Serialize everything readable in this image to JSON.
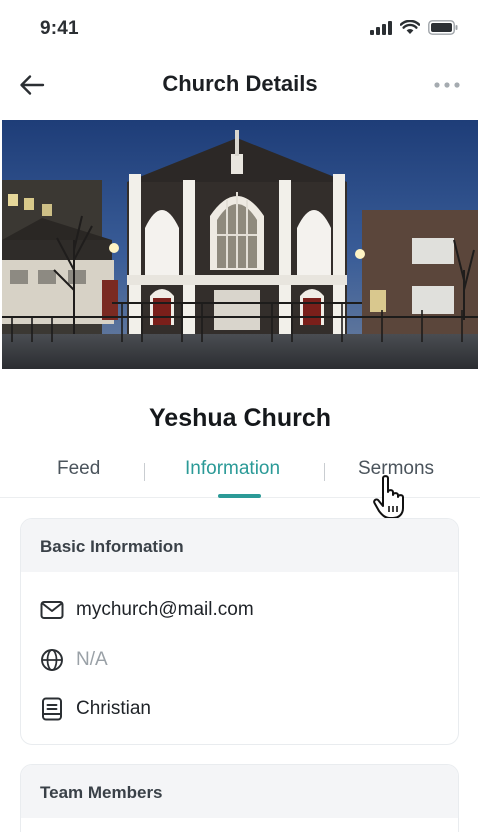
{
  "status_bar": {
    "time": "9:41"
  },
  "nav": {
    "title": "Church Details"
  },
  "church": {
    "name": "Yeshua Church"
  },
  "tabs": [
    {
      "label": "Feed",
      "active": false
    },
    {
      "label": "Information",
      "active": true
    },
    {
      "label": "Sermons",
      "active": false
    }
  ],
  "basic_info": {
    "title": "Basic Information",
    "email": "mychurch@mail.com",
    "website": "N/A",
    "denomination": "Christian"
  },
  "team": {
    "title": "Team Members"
  },
  "colors": {
    "accent": "#2b9a97",
    "muted_text": "#9aa1a7",
    "card_header_bg": "#f4f5f7"
  },
  "icons": [
    "back-arrow-icon",
    "more-dots-icon",
    "mail-icon",
    "globe-icon",
    "book-icon",
    "pointer-hand-icon",
    "signal-icon",
    "wifi-icon",
    "battery-icon"
  ]
}
